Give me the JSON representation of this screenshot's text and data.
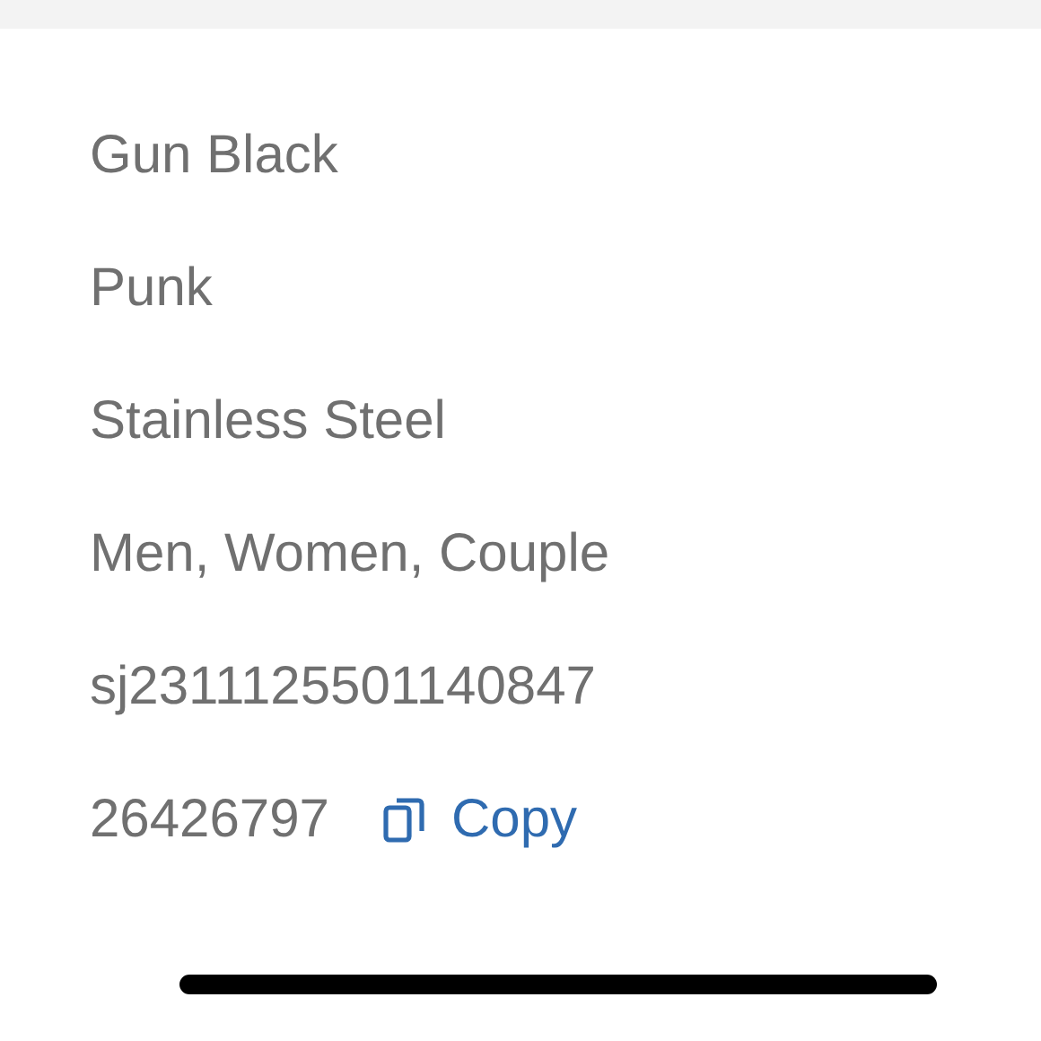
{
  "details": [
    "Gun Black",
    "Punk",
    "Stainless Steel",
    "Men, Women, Couple",
    "sj2311125501140847"
  ],
  "order_number": {
    "value": "26426797",
    "action": "Copy"
  }
}
